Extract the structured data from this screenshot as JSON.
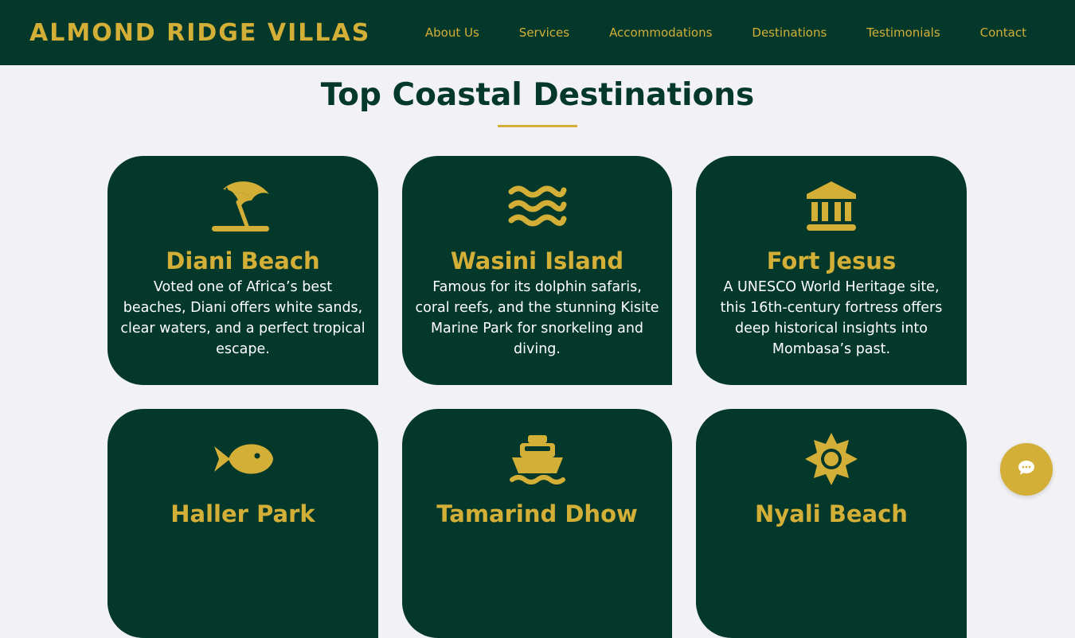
{
  "brand": {
    "name": "ALMOND RIDGE VILLAS"
  },
  "nav": {
    "items": [
      {
        "label": "About Us"
      },
      {
        "label": "Services"
      },
      {
        "label": "Accommodations"
      },
      {
        "label": "Destinations"
      },
      {
        "label": "Testimonials"
      },
      {
        "label": "Contact"
      }
    ]
  },
  "section": {
    "title": "Top Coastal Destinations"
  },
  "destinations": [
    {
      "icon": "beach-umbrella-icon",
      "title": "Diani Beach",
      "description": "Voted one of Africa’s best beaches, Diani offers white sands, clear waters, and a perfect tropical escape."
    },
    {
      "icon": "water-waves-icon",
      "title": "Wasini Island",
      "description": "Famous for its dolphin safaris, coral reefs, and the stunning Kisite Marine Park for snorkeling and diving."
    },
    {
      "icon": "landmark-icon",
      "title": "Fort Jesus",
      "description": "A UNESCO World Heritage site, this 16th-century fortress offers deep historical insights into Mombasa’s past."
    },
    {
      "icon": "fish-icon",
      "title": "Haller Park",
      "description": ""
    },
    {
      "icon": "ship-icon",
      "title": "Tamarind Dhow",
      "description": ""
    },
    {
      "icon": "sun-icon",
      "title": "Nyali Beach",
      "description": ""
    }
  ],
  "chat": {
    "icon": "chat-bubble-icon"
  },
  "colors": {
    "primary": "#03382a",
    "accent": "#d4af37",
    "background": "#f2f2f4"
  }
}
